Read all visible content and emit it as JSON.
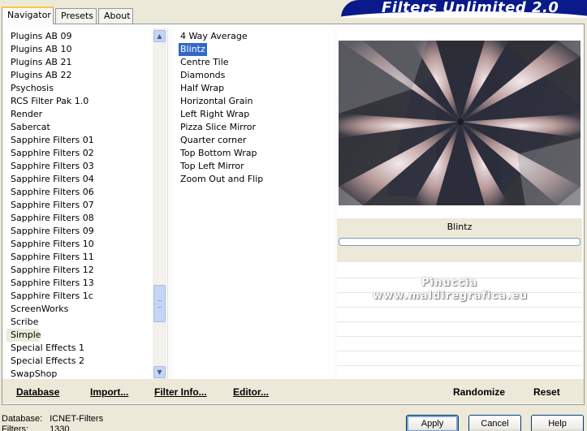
{
  "tabs": [
    {
      "label": "Navigator",
      "active": true
    },
    {
      "label": "Presets",
      "active": false
    },
    {
      "label": "About",
      "active": false
    }
  ],
  "banner": {
    "title": "Filters Unlimited 2.0"
  },
  "categories": [
    "Plugins AB 09",
    "Plugins AB 10",
    "Plugins AB 21",
    "Plugins AB 22",
    "Psychosis",
    "RCS Filter Pak 1.0",
    "Render",
    "Sabercat",
    "Sapphire Filters 01",
    "Sapphire Filters 02",
    "Sapphire Filters 03",
    "Sapphire Filters 04",
    "Sapphire Filters 06",
    "Sapphire Filters 07",
    "Sapphire Filters 08",
    "Sapphire Filters 09",
    "Sapphire Filters 10",
    "Sapphire Filters 11",
    "Sapphire Filters 12",
    "Sapphire Filters 13",
    "Sapphire Filters 1c",
    "ScreenWorks",
    "Scribe",
    "Simple",
    "Special Effects 1",
    "Special Effects 2",
    "SwapShop"
  ],
  "selected_category": "Simple",
  "filters": [
    "4 Way Average",
    "Blintz",
    "Centre Tile",
    "Diamonds",
    "Half Wrap",
    "Horizontal Grain",
    "Left Right Wrap",
    "Pizza Slice Mirror",
    "Quarter corner",
    "Top Bottom Wrap",
    "Top Left Mirror",
    "Zoom Out and Flip"
  ],
  "selected_filter": "Blintz",
  "preview": {
    "filter_name": "Blintz",
    "watermark_line1": "Pinuccia",
    "watermark_line2": "www.maldiregrafica.eu"
  },
  "toolbar": {
    "database": "Database",
    "import": "Import...",
    "filter_info": "Filter Info...",
    "editor": "Editor...",
    "randomize": "Randomize",
    "reset": "Reset"
  },
  "status": {
    "database_label": "Database:",
    "database_value": "ICNET-Filters",
    "filters_label": "Filters:",
    "filters_value": "1330"
  },
  "buttons": {
    "apply": "Apply",
    "cancel": "Cancel",
    "help": "Help"
  },
  "colors": {
    "selection": "#316ac5",
    "banner": "#0a1a8a"
  }
}
